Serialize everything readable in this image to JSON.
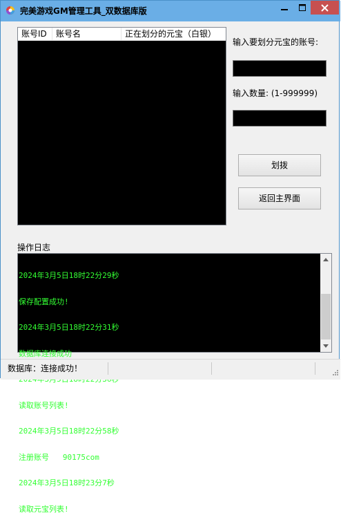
{
  "window": {
    "title": "完美游戏GM管理工具_双数据库版"
  },
  "titlebar": {
    "icon": "app-logo-icon",
    "minimize_icon": "minimize-icon",
    "maximize_icon": "maximize-icon",
    "close_icon": "close-icon"
  },
  "account_list": {
    "columns": [
      "账号ID",
      "账号名",
      "正在划分的元宝（白银）"
    ],
    "rows": []
  },
  "form": {
    "account_label": "输入要划分元宝的账号:",
    "account_value": "",
    "quantity_label": "输入数量: (1-999999)",
    "quantity_value": "",
    "transfer_button": "划拨",
    "back_button": "返回主界面"
  },
  "log": {
    "label": "操作日志",
    "lines": [
      "2024年3月5日18时22分29秒",
      "保存配置成功!",
      "2024年3月5日18时22分31秒",
      "数据库连接成功",
      "2024年3月5日18时22分36秒",
      "读取账号列表!",
      "2024年3月5日18时22分58秒",
      "注册账号   90175com",
      "2024年3月5日18时23分7秒",
      "读取元宝列表!"
    ],
    "text_color": "#33ff33"
  },
  "statusbar": {
    "pane1": "数据库：连接成功！",
    "pane2": "",
    "pane3": ""
  },
  "colors": {
    "titlebar": "#6aaee6",
    "close_button": "#c75050",
    "panel_background": "#000000"
  }
}
